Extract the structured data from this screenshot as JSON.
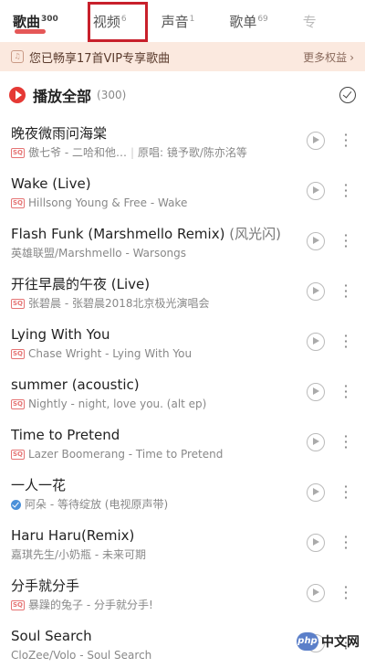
{
  "tabs": [
    {
      "label": "歌曲",
      "count": "300"
    },
    {
      "label": "视频",
      "count": "6"
    },
    {
      "label": "声音",
      "count": "1"
    },
    {
      "label": "歌单",
      "count": "69"
    },
    {
      "label": "专",
      "count": ""
    }
  ],
  "vip_bar": {
    "text": "您已畅享17首VIP专享歌曲",
    "more": "更多权益",
    "more_arrow": "›"
  },
  "play_all": {
    "label": "播放全部",
    "count": "(300)"
  },
  "songs": [
    {
      "title": "晚夜微雨问海棠",
      "alt": "",
      "badge": "sq",
      "artist_album": "傲七爷 - 二哈和他…",
      "extra": "原唱: 镜予歌/陈亦洺等"
    },
    {
      "title": "Wake (Live)",
      "alt": "",
      "badge": "sq",
      "artist_album": "Hillsong Young & Free - Wake",
      "extra": ""
    },
    {
      "title": "Flash Funk (Marshmello Remix)",
      "alt": "(风光闪)",
      "badge": "",
      "artist_album": "英雄联盟/Marshmello - Warsongs",
      "extra": ""
    },
    {
      "title": "开往早晨的午夜 (Live)",
      "alt": "",
      "badge": "sq",
      "artist_album": "张碧晨 - 张碧晨2018北京极光演唱会",
      "extra": ""
    },
    {
      "title": "Lying With You",
      "alt": "",
      "badge": "sq",
      "artist_album": "Chase Wright - Lying With You",
      "extra": ""
    },
    {
      "title": "summer (acoustic)",
      "alt": "",
      "badge": "sq",
      "artist_album": "Nightly - night, love you. (alt ep)",
      "extra": ""
    },
    {
      "title": "Time to Pretend",
      "alt": "",
      "badge": "sq",
      "artist_album": "Lazer Boomerang - Time to Pretend",
      "extra": ""
    },
    {
      "title": "一人一花",
      "alt": "",
      "badge": "verified",
      "artist_album": "阿朵 - 等待绽放 (电视原声带)",
      "extra": ""
    },
    {
      "title": "Haru Haru(Remix)",
      "alt": "",
      "badge": "",
      "artist_album": "嘉琪先生/小奶瓶 - 未来可期",
      "extra": ""
    },
    {
      "title": "分手就分手",
      "alt": "",
      "badge": "sq",
      "artist_album": "暴躁的兔子 - 分手就分手!",
      "extra": ""
    },
    {
      "title": "Soul Search",
      "alt": "",
      "badge": "",
      "artist_album": "CloZee/Volo - Soul Search",
      "extra": ""
    }
  ],
  "badge_text": {
    "sq": "SQ"
  },
  "watermark": {
    "logo": "php",
    "text": "中文网"
  },
  "colors": {
    "accent": "#e53935",
    "vip_bg": "#fbe9df",
    "highlight_box": "#c8202b"
  }
}
